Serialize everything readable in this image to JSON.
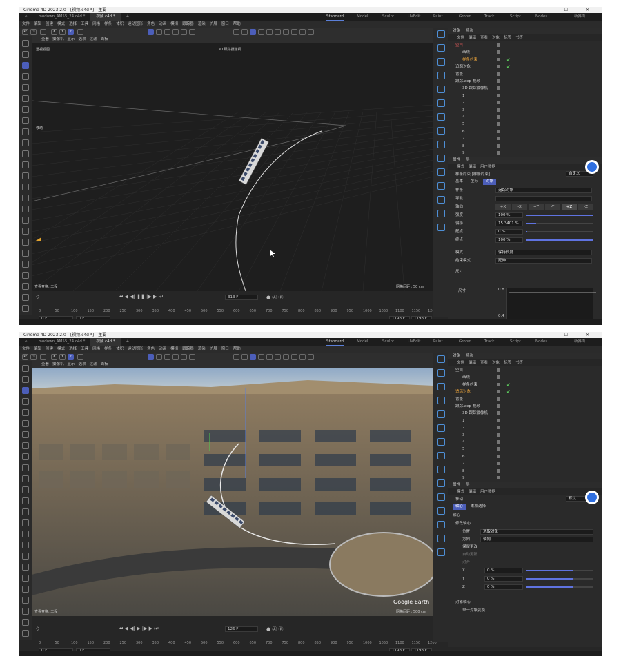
{
  "windows": [
    {
      "title": "Cinema 4D 2023.2.0 - [视频.c4d *] - 主要",
      "doc_tabs": [
        "modown_AM55_24.c4d *",
        "视频.c4d *"
      ],
      "workspaces": [
        "Standard",
        "Model",
        "Sculpt",
        "UVEdit",
        "Paint",
        "Groom",
        "Track",
        "Script",
        "Nodes"
      ],
      "new_interface_label": "新界面",
      "menu": [
        "文件",
        "编辑",
        "创建",
        "模式",
        "选择",
        "工具",
        "网格",
        "样条",
        "体积",
        "运动图形",
        "角色",
        "动画",
        "模拟",
        "跟踪器",
        "渲染",
        "扩展",
        "窗口",
        "帮助"
      ],
      "axis_buttons": [
        "X",
        "Y",
        "Z"
      ],
      "viewport_menu": [
        "查看",
        "摄像机",
        "显示",
        "选项",
        "过滤",
        "面板"
      ],
      "viewport_name": "透视视图",
      "camera_label": "3D 跟踪摄像机",
      "move_label": "移动",
      "view_transform": "查看变换: 工程",
      "grid_spacing": "网格间距 : 50 cm",
      "current_frame": "313 F",
      "ruler": [
        "0",
        "50",
        "100",
        "150",
        "200",
        "250",
        "300",
        "350",
        "400",
        "450",
        "500",
        "550",
        "600",
        "650",
        "700",
        "750",
        "800",
        "850",
        "900",
        "950",
        "1000",
        "1050",
        "1100",
        "1150",
        "1200"
      ],
      "start_frame": "0 F",
      "start_frame2": "0 F",
      "end_frame": "1198 F",
      "end_frame2": "1198 F",
      "obj_tabs": [
        "对象",
        "场次"
      ],
      "obj_menu": [
        "文件",
        "编辑",
        "查看",
        "对象",
        "标签",
        "书签"
      ],
      "objects": [
        {
          "name": "空白",
          "indent": 0,
          "color": "#e05a5a",
          "check": ""
        },
        {
          "name": "画线",
          "indent": 1,
          "color": "#cfcfcf",
          "check": ""
        },
        {
          "name": "样条约束",
          "indent": 1,
          "color": "#e8a23b",
          "check": "✔"
        },
        {
          "name": "追踪对象",
          "indent": 0,
          "color": "#cfcfcf",
          "check": "✔"
        },
        {
          "name": "背景",
          "indent": 0,
          "color": "#cfcfcf",
          "check": ""
        },
        {
          "name": "跟踪.aep-视频",
          "indent": 0,
          "color": "#cfcfcf",
          "check": ""
        },
        {
          "name": "3D 跟踪摄像机",
          "indent": 1,
          "color": "#cfcfcf",
          "check": ""
        },
        {
          "name": "1",
          "indent": 1,
          "color": "#cfcfcf",
          "check": ""
        },
        {
          "name": "2",
          "indent": 1,
          "color": "#cfcfcf",
          "check": ""
        },
        {
          "name": "3",
          "indent": 1,
          "color": "#cfcfcf",
          "check": ""
        },
        {
          "name": "4",
          "indent": 1,
          "color": "#cfcfcf",
          "check": ""
        },
        {
          "name": "5",
          "indent": 1,
          "color": "#cfcfcf",
          "check": ""
        },
        {
          "name": "6",
          "indent": 1,
          "color": "#cfcfcf",
          "check": ""
        },
        {
          "name": "7",
          "indent": 1,
          "color": "#cfcfcf",
          "check": ""
        },
        {
          "name": "8",
          "indent": 1,
          "color": "#cfcfcf",
          "check": ""
        },
        {
          "name": "9",
          "indent": 1,
          "color": "#cfcfcf",
          "check": ""
        }
      ],
      "attr_tabs": [
        "属性",
        "层"
      ],
      "attr_menu": [
        "模式",
        "编辑",
        "用户数据"
      ],
      "attr_title": "样条约束 [样条约束]",
      "attr_default": "自定义",
      "attr_subtabs": [
        "基本",
        "坐标",
        "对象"
      ],
      "attr_subtab_active": 2,
      "attrs": {
        "spline_label": "样条",
        "spline_value": "追踪对象",
        "rail_label": "导轨",
        "axis_label": "轴向",
        "axis_options": [
          "+X",
          "-X",
          "+Y",
          "-Y",
          "+Z",
          "-Z"
        ],
        "axis_active": 4,
        "strength_label": "强度",
        "strength_value": "100 %",
        "offset_label": "偏移",
        "offset_value": "15.3401 %",
        "start_label": "起点",
        "start_value": "0 %",
        "end_label": "终点",
        "end_value": "100 %",
        "mode_label": "模式",
        "mode_value": "保持长度",
        "endmode_label": "结束模式",
        "endmode_value": "延伸",
        "size_section": "尺寸",
        "size_label": "尺寸",
        "size_graph_y1": "0.8",
        "size_graph_y2": "0.4",
        "strength_fill": 1.0,
        "offset_fill": 0.153,
        "start_fill": 0.0,
        "end_fill": 1.0
      }
    },
    {
      "title": "Cinema 4D 2023.2.0 - [视频.c4d *] - 主要",
      "doc_tabs": [
        "modown_AM55_24.c4d *",
        "视频.c4d *"
      ],
      "workspaces": [
        "Standard",
        "Model",
        "Sculpt",
        "UVEdit",
        "Paint",
        "Groom",
        "Track",
        "Script",
        "Nodes"
      ],
      "new_interface_label": "新界面",
      "menu": [
        "文件",
        "编辑",
        "创建",
        "模式",
        "选择",
        "工具",
        "网格",
        "样条",
        "体积",
        "运动图形",
        "角色",
        "动画",
        "模拟",
        "跟踪器",
        "渲染",
        "扩展",
        "窗口",
        "帮助"
      ],
      "axis_buttons": [
        "X",
        "Y",
        "Z"
      ],
      "viewport_menu": [
        "查看",
        "摄像机",
        "显示",
        "选项",
        "过滤",
        "面板"
      ],
      "viewport_name": "",
      "camera_label": "",
      "move_label": "",
      "view_transform": "查看变换: 工程",
      "grid_spacing": "网格间距 : 500 cm",
      "watermark": "Google Earth",
      "current_frame": "126 F",
      "ruler": [
        "0",
        "50",
        "100",
        "150",
        "200",
        "250",
        "300",
        "350",
        "400",
        "450",
        "500",
        "550",
        "600",
        "650",
        "700",
        "750",
        "800",
        "850",
        "900",
        "950",
        "1000",
        "1050",
        "1100",
        "1150",
        "1200"
      ],
      "start_frame": "0 F",
      "start_frame2": "0 F",
      "end_frame": "1198 F",
      "end_frame2": "1198 F",
      "obj_tabs": [
        "对象",
        "场次"
      ],
      "obj_menu": [
        "文件",
        "编辑",
        "查看",
        "对象",
        "标签",
        "书签"
      ],
      "objects": [
        {
          "name": "空白",
          "indent": 0,
          "color": "#cfcfcf",
          "check": ""
        },
        {
          "name": "画线",
          "indent": 1,
          "color": "#cfcfcf",
          "check": ""
        },
        {
          "name": "样条约束",
          "indent": 1,
          "color": "#cfcfcf",
          "check": "✔"
        },
        {
          "name": "追踪对象",
          "indent": 0,
          "color": "#e8a23b",
          "check": "✔"
        },
        {
          "name": "背景",
          "indent": 0,
          "color": "#cfcfcf",
          "check": ""
        },
        {
          "name": "跟踪.aep-视频",
          "indent": 0,
          "color": "#cfcfcf",
          "check": ""
        },
        {
          "name": "3D 跟踪摄像机",
          "indent": 1,
          "color": "#cfcfcf",
          "check": ""
        },
        {
          "name": "1",
          "indent": 1,
          "color": "#cfcfcf",
          "check": ""
        },
        {
          "name": "2",
          "indent": 1,
          "color": "#cfcfcf",
          "check": ""
        },
        {
          "name": "3",
          "indent": 1,
          "color": "#cfcfcf",
          "check": ""
        },
        {
          "name": "4",
          "indent": 1,
          "color": "#cfcfcf",
          "check": ""
        },
        {
          "name": "5",
          "indent": 1,
          "color": "#cfcfcf",
          "check": ""
        },
        {
          "name": "6",
          "indent": 1,
          "color": "#cfcfcf",
          "check": ""
        },
        {
          "name": "7",
          "indent": 1,
          "color": "#cfcfcf",
          "check": ""
        },
        {
          "name": "8",
          "indent": 1,
          "color": "#cfcfcf",
          "check": ""
        },
        {
          "name": "9",
          "indent": 1,
          "color": "#cfcfcf",
          "check": ""
        }
      ],
      "attr_tabs": [
        "属性",
        "层"
      ],
      "attr_menu": [
        "模式",
        "编辑",
        "用户数据"
      ],
      "attr_title": "移动",
      "attr_default": "默认",
      "attr_subtabs": [
        "轴心",
        "柔和选择"
      ],
      "attr_subtab_active": 0,
      "attrs2": {
        "section": "轴心",
        "modify_axis": "修改轴心",
        "pos_label": "位置",
        "pos_value": "选取对象",
        "dir_label": "方向",
        "dir_value": "轴向",
        "keep_label": "保留更改",
        "auto_label": "自动更新",
        "align_label": "对齐",
        "x_label": "X",
        "x_value": "0 %",
        "y_label": "Y",
        "y_value": "0 %",
        "z_label": "Z",
        "z_value": "0 %",
        "obj_axis": "对象轴心",
        "single_label": "单一对象变换"
      }
    }
  ]
}
